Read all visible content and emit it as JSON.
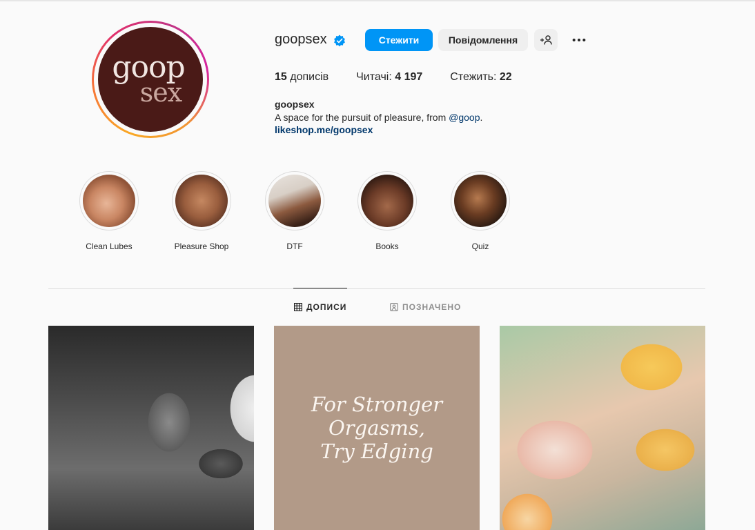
{
  "profile": {
    "username": "goopsex",
    "avatar_logo": {
      "line1": "goop",
      "line2": "sex"
    },
    "verified": true
  },
  "actions": {
    "follow_label": "Стежити",
    "message_label": "Повідомлення",
    "suggest_icon": "person-add-icon",
    "more_icon": "more-horizontal-icon"
  },
  "stats": {
    "posts_count": "15",
    "posts_label": "дописів",
    "followers_label": "Читачі:",
    "followers_count": "4 197",
    "following_label": "Стежить:",
    "following_count": "22"
  },
  "bio": {
    "name": "goopsex",
    "text": "A space for the pursuit of pleasure, from ",
    "mention": "@goop",
    "text_end": ".",
    "link": "likeshop.me/goopsex"
  },
  "highlights": [
    {
      "label": "Clean Lubes"
    },
    {
      "label": "Pleasure Shop"
    },
    {
      "label": "DTF"
    },
    {
      "label": "Books"
    },
    {
      "label": "Quiz"
    }
  ],
  "tabs": {
    "posts_label": "ДОПИСИ",
    "tagged_label": "ПОЗНАЧЕНО",
    "active": "posts"
  },
  "posts": [
    {
      "type": "photo"
    },
    {
      "type": "text",
      "text_lines": [
        "For Stronger",
        "Orgasms,",
        "Try Edging"
      ]
    },
    {
      "type": "photo"
    }
  ],
  "colors": {
    "follow_button": "#0095f6",
    "secondary_button": "#efefef",
    "link": "#00376b",
    "avatar_bg": "#4a1a17",
    "post2_bg": "#b29a88"
  }
}
